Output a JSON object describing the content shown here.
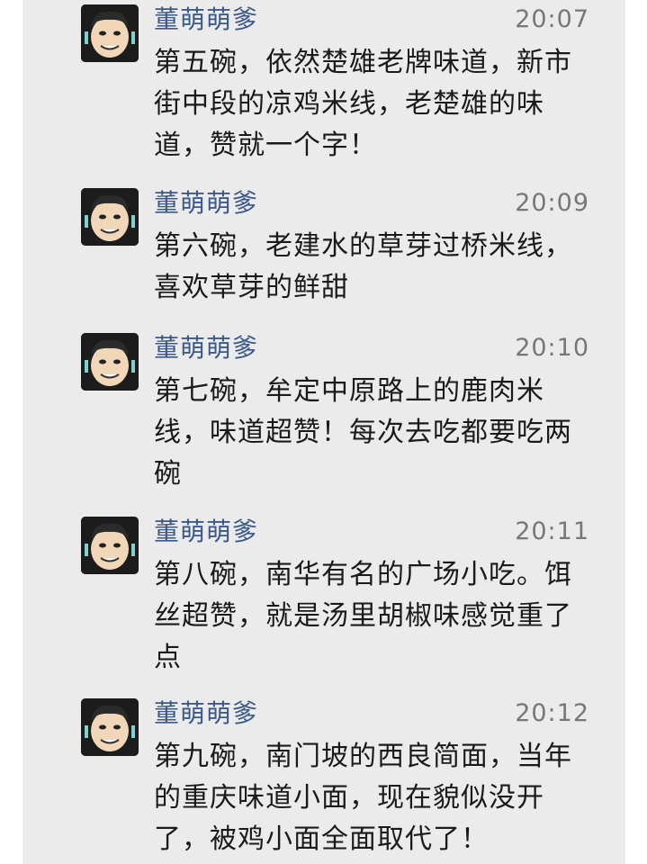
{
  "messages": [
    {
      "sender": "董萌萌爹",
      "time": "20:07",
      "text": "第五碗，依然楚雄老牌味道，新市街中段的凉鸡米线，老楚雄的味道，赞就一个字！"
    },
    {
      "sender": "董萌萌爹",
      "time": "20:09",
      "text": "第六碗，老建水的草芽过桥米线，喜欢草芽的鲜甜"
    },
    {
      "sender": "董萌萌爹",
      "time": "20:10",
      "text": "第七碗，牟定中原路上的鹿肉米线，味道超赞！每次去吃都要吃两碗"
    },
    {
      "sender": "董萌萌爹",
      "time": "20:11",
      "text": "第八碗，南华有名的广场小吃。饵丝超赞，就是汤里胡椒味感觉重了点"
    },
    {
      "sender": "董萌萌爹",
      "time": "20:12",
      "text": "第九碗，南门坡的西良简面，当年的重庆味道小面，现在貌似没开了，被鸡小面全面取代了！"
    }
  ],
  "icons": {
    "avatar": "cartoon-face-avatar"
  }
}
